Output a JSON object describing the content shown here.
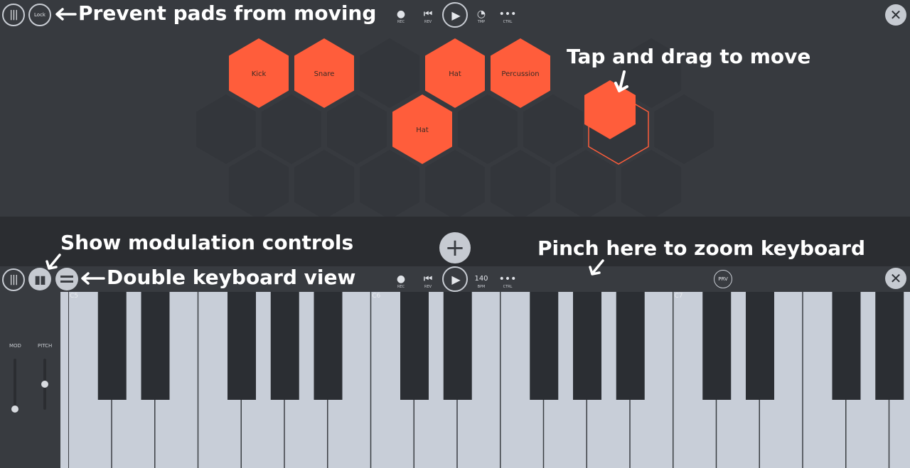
{
  "top_bar": {
    "lock_label": "Lock",
    "transport": {
      "rec": "REC",
      "rev": "REV",
      "tmp": "TMP",
      "ctrl": "CTRL"
    },
    "close_glyph": "✕"
  },
  "pads": [
    {
      "label": "Kick",
      "state": "assigned"
    },
    {
      "label": "Snare",
      "state": "assigned"
    },
    {
      "label": "Hat",
      "state": "assigned"
    },
    {
      "label": "Percussion",
      "state": "assigned"
    },
    {
      "label": "Hat",
      "state": "assigned"
    }
  ],
  "annotations": {
    "prevent": "Prevent pads from moving",
    "tap_drag": "Tap and drag to move",
    "show_mod": "Show modulation controls",
    "double_kb": "Double keyboard view",
    "pinch": "Pinch here to zoom keyboard"
  },
  "add_glyph": "+",
  "keyboard_bar": {
    "transport": {
      "rec": "REC",
      "rev": "REV",
      "bpm_value": "140",
      "bpm": "BPM",
      "ctrl": "CTRL"
    },
    "prv": "PRV",
    "close_glyph": "✕"
  },
  "keyboard": {
    "octave_labels": [
      "C5",
      "C6",
      "C7"
    ],
    "mod_label": "MOD",
    "pitch_label": "PITCH",
    "mod_value": 0.0,
    "pitch_value": 0.5
  },
  "colors": {
    "pad_active": "#ff5d3b",
    "pad_empty": "#33363b",
    "background": "#373a3f",
    "white_key": "#c8ced8",
    "black_key": "#2b2e33"
  }
}
